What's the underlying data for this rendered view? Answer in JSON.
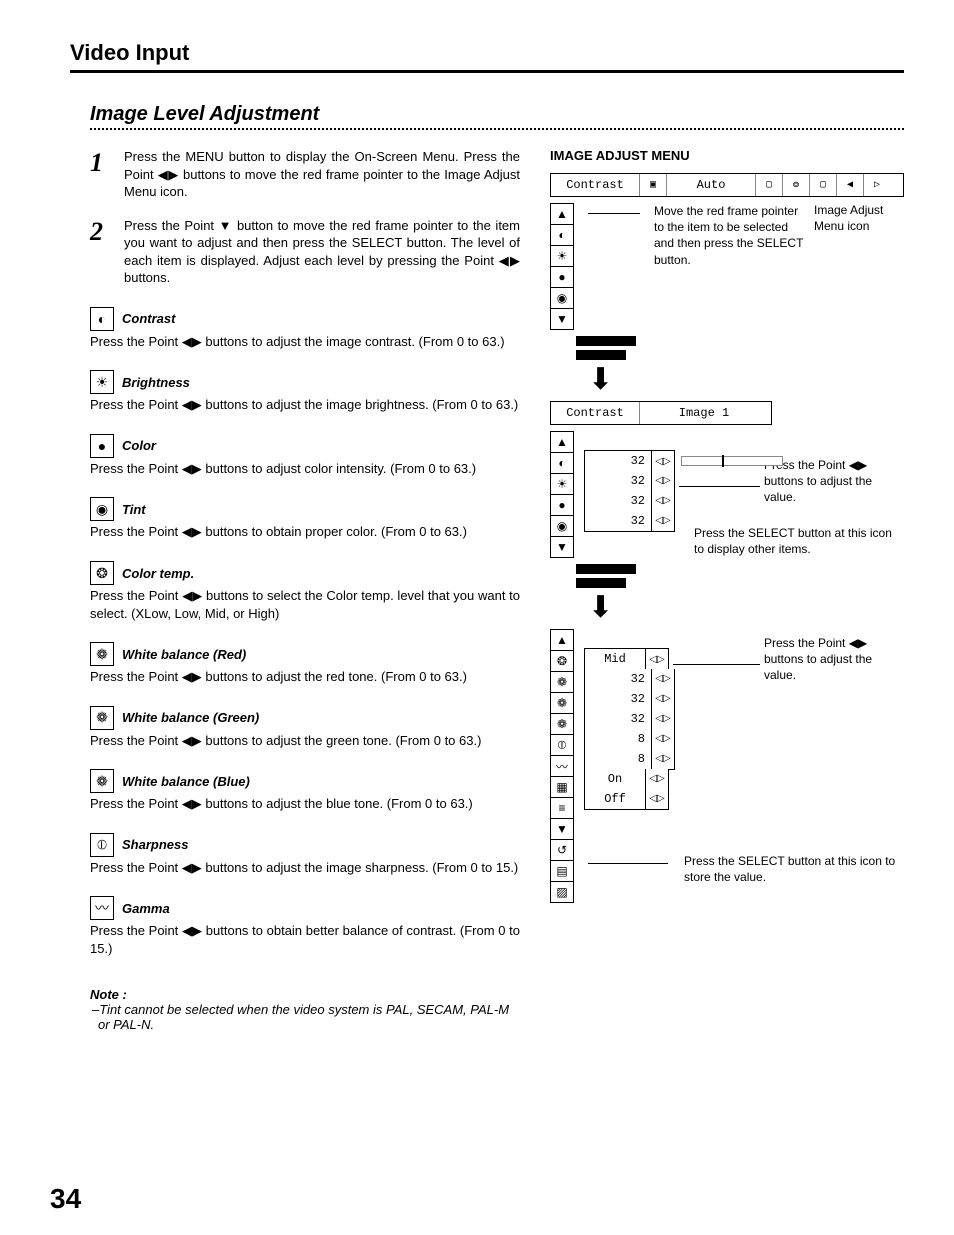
{
  "header": "Video Input",
  "subheader": "Image Level  Adjustment",
  "steps": [
    {
      "num": "1",
      "text": "Press the MENU button to display the On-Screen Menu.  Press the Point ◀▶ buttons to move the red frame pointer to the Image Adjust Menu icon."
    },
    {
      "num": "2",
      "text": "Press the Point ▼ button to move the red frame pointer to the item you want to adjust and then press the SELECT button.  The level of each item is displayed.  Adjust each level by pressing the Point ◀▶ buttons."
    }
  ],
  "adjustments": [
    {
      "icon": "◐",
      "label": "Contrast",
      "desc": "Press the Point ◀▶ buttons to adjust the image contrast. (From 0 to 63.)"
    },
    {
      "icon": "☀",
      "label": "Brightness",
      "desc": "Press the Point ◀▶ buttons to adjust the image brightness. (From 0 to 63.)"
    },
    {
      "icon": "●",
      "label": "Color",
      "desc": "Press the Point ◀▶ buttons to adjust color intensity.  (From 0 to 63.)"
    },
    {
      "icon": "◉",
      "label": "Tint",
      "desc": "Press the Point ◀▶ buttons to obtain proper color.  (From 0 to 63.)"
    },
    {
      "icon": "❂",
      "label": "Color temp.",
      "desc": "Press the Point ◀▶ buttons to select the Color temp. level that you want to select.  (XLow, Low, Mid, or High)"
    },
    {
      "icon": "❁",
      "label": "White balance  (Red)",
      "desc": "Press the Point ◀▶ buttons to adjust the red tone.  (From 0 to 63.)"
    },
    {
      "icon": "❁",
      "label": "White balance  (Green)",
      "desc": "Press the Point ◀▶ buttons to adjust the green tone.  (From 0 to 63.)"
    },
    {
      "icon": "❁",
      "label": "White balance  (Blue)",
      "desc": "Press the Point ◀▶ buttons to adjust the blue tone.  (From 0 to 63.)"
    },
    {
      "icon": "⦶",
      "label": "Sharpness",
      "desc": "Press the Point ◀▶ buttons to adjust the image sharpness.  (From 0 to  15.)"
    },
    {
      "icon": "〰",
      "label": "Gamma",
      "desc": "Press the Point ◀▶ buttons to obtain better balance of contrast. (From 0 to 15.)"
    }
  ],
  "note": {
    "title": "Note :",
    "text": "–Tint cannot be selected when the video system is PAL, SECAM, PAL-M or PAL-N."
  },
  "menu_title": "IMAGE ADJUST MENU",
  "osd": {
    "contrast": "Contrast",
    "auto": "Auto",
    "image1": "Image 1",
    "ann_move": "Move the red frame pointer to the item to be selected and then press the SELECT button.",
    "ann_menu_icon": "Image Adjust Menu icon",
    "ann_point": "Press the Point ◀▶ buttons to adjust the value.",
    "ann_select_other": "Press the SELECT button at this icon to display other items.",
    "ann_select_store": "Press the SELECT button at this icon to store the value.",
    "vals1": [
      "32",
      "32",
      "32",
      "32"
    ],
    "vals2": [
      "Mid",
      "32",
      "32",
      "32",
      "8",
      "8",
      "On",
      "Off"
    ]
  },
  "icons_col1": [
    "▲",
    "◐",
    "☀",
    "●",
    "◉",
    "▼"
  ],
  "icons_col2": [
    "▲",
    "◐",
    "☀",
    "●",
    "◉",
    "▼"
  ],
  "icons_col3": [
    "▲",
    "❂",
    "❁",
    "❁",
    "❁",
    "⦶",
    "〰",
    "▦",
    "≡",
    "▼",
    "↺",
    "▤",
    "▨"
  ],
  "page_num": "34"
}
